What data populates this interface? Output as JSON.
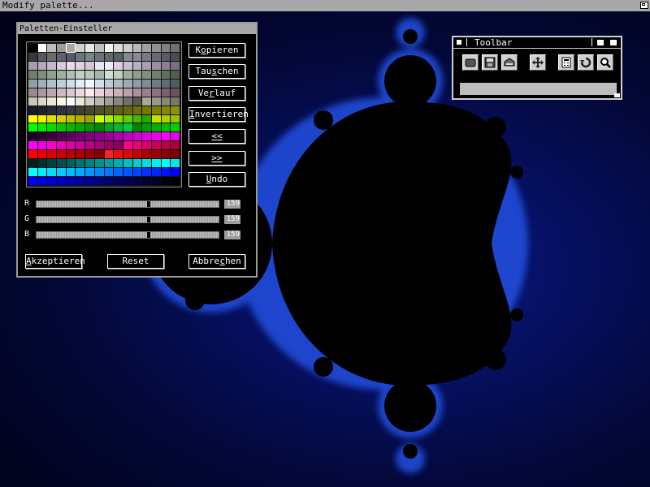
{
  "window_title": "Modify palette...",
  "palette_window": {
    "title": "Paletten-Einsteller",
    "buttons": {
      "copy": {
        "pre": "K",
        "u": "o",
        "post": "pieren"
      },
      "swap": {
        "pre": "Tau",
        "u": "s",
        "post": "chen"
      },
      "gradient": {
        "pre": "Ve",
        "u": "r",
        "post": "lauf"
      },
      "invert": {
        "pre": "",
        "u": "I",
        "post": "nvertieren"
      },
      "shift_left": {
        "pre": "",
        "u": "<",
        "post": "<"
      },
      "shift_right": {
        "pre": "",
        "u": ">",
        "post": ">"
      },
      "undo": {
        "pre": "",
        "u": "U",
        "post": "ndo"
      },
      "accept": {
        "pre": "",
        "u": "A",
        "post": "kzeptieren"
      },
      "reset": {
        "pre": "Reset",
        "u": "",
        "post": ""
      },
      "cancel": {
        "pre": "Abbre",
        "u": "c",
        "post": "hen"
      }
    },
    "sliders": [
      {
        "label": "R",
        "value": "159",
        "level": 0.62
      },
      {
        "label": "G",
        "value": "159",
        "level": 0.62
      },
      {
        "label": "B",
        "value": "159",
        "level": 0.62
      }
    ],
    "selected_swatch_index": 4,
    "swatch_rows": [
      [
        "#000000",
        "#ffffff",
        "#bdbdbd",
        "#9c9c9c",
        "#a8a8a8",
        "#d0d0d0",
        "#e8e8e8",
        "#c0c0c0",
        "#f4f4f4",
        "#dcdcdc",
        "#cccccc",
        "#b8b8b8",
        "#a0a0a0",
        "#909090",
        "#808080",
        "#707070"
      ],
      [
        "#383838",
        "#585858",
        "#6c6c6c",
        "#606070",
        "#585868",
        "#687878",
        "#788888",
        "#707080",
        "#606868",
        "#586060",
        "#808890",
        "#888898",
        "#7a7a84",
        "#6a6a74",
        "#5a5a64",
        "#4a4a54"
      ],
      [
        "#a89cb0",
        "#b4a8bc",
        "#c4b8cc",
        "#d8ccd8",
        "#e8dce8",
        "#dcd4e0",
        "#d0c8d4",
        "#e8e4f0",
        "#f0ecf4",
        "#d8d0e0",
        "#c8c0d0",
        "#b8b0c0",
        "#a8a0b0",
        "#9890a0",
        "#888090",
        "#787080"
      ],
      [
        "#708070",
        "#809080",
        "#90a090",
        "#a0b0a0",
        "#b0c0b0",
        "#c0d0c0",
        "#b8c8b8",
        "#a8b8a8",
        "#d0e0d0",
        "#c0d0c0",
        "#a0b0a0",
        "#909c90",
        "#809080",
        "#708070",
        "#607060",
        "#506050"
      ],
      [
        "#90a0a8",
        "#a0b0b8",
        "#b0c0c8",
        "#c0d0d8",
        "#d0e0e8",
        "#e0f0f8",
        "#f0f8ff",
        "#d0e0e8",
        "#c0ccd4",
        "#b0bcc4",
        "#a0acb4",
        "#909ca4",
        "#808c94",
        "#707c84",
        "#606c74",
        "#505c64"
      ],
      [
        "#9c8890",
        "#ac98a0",
        "#bca8b0",
        "#ccb8c0",
        "#dcc8d0",
        "#ecd8e0",
        "#fce8f0",
        "#ecd0dc",
        "#dcc0cc",
        "#ccb0bc",
        "#bca0ac",
        "#ac909c",
        "#9c808c",
        "#8c707c",
        "#7c606c",
        "#6c505c"
      ],
      [
        "#c8c8b8",
        "#d8d8c8",
        "#e8e8d8",
        "#f8f8e8",
        "#ffffff",
        "#e8e8e0",
        "#d0d0c8",
        "#b8b8b0",
        "#a0a098",
        "#888880",
        "#707068",
        "#585850",
        "#a8a898",
        "#989888",
        "#888878",
        "#787868"
      ],
      [
        "#181828",
        "#202030",
        "#282838",
        "#303040",
        "#383840",
        "#404038",
        "#484830",
        "#505028",
        "#585820",
        "#606018",
        "#686810",
        "#707008",
        "#787800",
        "#808000",
        "#888800",
        "#909000"
      ],
      [
        "#ffff00",
        "#f0f000",
        "#e0e000",
        "#d0d000",
        "#c0c000",
        "#b0b000",
        "#a0a000",
        "#ccff00",
        "#aaee00",
        "#88dd00",
        "#66cc00",
        "#44bb00",
        "#22aa00",
        "#c8e000",
        "#b0d000",
        "#98c000"
      ],
      [
        "#00ff00",
        "#00ee00",
        "#00dd00",
        "#00cc00",
        "#00bb00",
        "#00aa00",
        "#009900",
        "#008800",
        "#00aa20",
        "#00bb30",
        "#00cc40",
        "#008800",
        "#00a000",
        "#00b000",
        "#00c000",
        "#00d000"
      ],
      [
        "#200020",
        "#300030",
        "#400040",
        "#500050",
        "#600060",
        "#700070",
        "#800080",
        "#900090",
        "#a000a0",
        "#b000b0",
        "#c000c0",
        "#d000d0",
        "#e000e0",
        "#f000f0",
        "#ff00ff",
        "#e800e8"
      ],
      [
        "#ff00ff",
        "#ee00ee",
        "#ff00cc",
        "#ee00bb",
        "#dd00aa",
        "#cc0099",
        "#bb0088",
        "#aa0077",
        "#990066",
        "#880055",
        "#ff0088",
        "#ee0077",
        "#dd0066",
        "#cc0055",
        "#bb0044",
        "#aa0033"
      ],
      [
        "#ff0000",
        "#ee0000",
        "#dd0000",
        "#cc0000",
        "#bb0000",
        "#aa0000",
        "#990000",
        "#880000",
        "#ff2020",
        "#ee1010",
        "#dd0808",
        "#cc0000",
        "#b00000",
        "#a00000",
        "#900000",
        "#800000"
      ],
      [
        "#002020",
        "#003030",
        "#004040",
        "#005050",
        "#006060",
        "#007070",
        "#008080",
        "#009090",
        "#00a0a0",
        "#00b0b0",
        "#00c0c0",
        "#00d0d0",
        "#00e0e0",
        "#00f0f0",
        "#00ffff",
        "#00e8e8"
      ],
      [
        "#00ffff",
        "#00eeff",
        "#00ddff",
        "#00ccff",
        "#00bbff",
        "#00aaff",
        "#0099ff",
        "#0088ff",
        "#0077ff",
        "#0066ff",
        "#0055ff",
        "#0044ff",
        "#0033ff",
        "#0022ff",
        "#0011ff",
        "#0000ff"
      ],
      [
        "#0000ff",
        "#0000ee",
        "#0000dd",
        "#0000cc",
        "#0000bb",
        "#0000aa",
        "#000099",
        "#000088",
        "#000077",
        "#000066",
        "#000055",
        "#000044",
        "#000033",
        "#000022",
        "#000011",
        "#000000"
      ]
    ]
  },
  "toolbar_window": {
    "title": "Toolbar",
    "icons": [
      "open-icon",
      "save-icon",
      "print-icon",
      "move-icon",
      "calculator-icon",
      "undo-icon",
      "zoom-icon"
    ]
  },
  "colors": {
    "title_bar": "#a8a8a8",
    "fractal_set": "#000000",
    "fractal_edge": "#3060ff"
  }
}
